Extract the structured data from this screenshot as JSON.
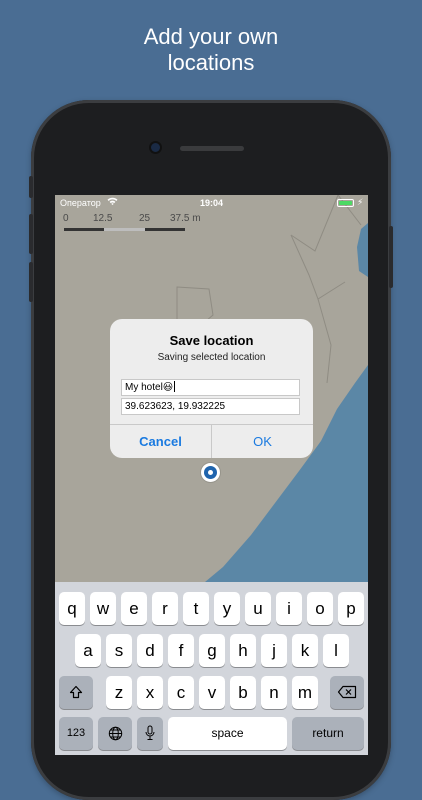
{
  "headline": {
    "line1": "Add your own",
    "line2": "locations"
  },
  "status": {
    "carrier": "Оператор",
    "time": "19:04"
  },
  "map": {
    "scale_labels": [
      "0",
      "12.5",
      "25",
      "37.5 m"
    ],
    "colors": {
      "land": "#a8a59b",
      "water": "#5b87a6",
      "road": "#8f8c83"
    }
  },
  "dialog": {
    "title": "Save location",
    "subtitle": "Saving selected location",
    "name_value": "My hotel😃",
    "coords_value": "39.623623, 19.932225",
    "cancel_label": "Cancel",
    "ok_label": "OK"
  },
  "keyboard": {
    "row1": [
      "q",
      "w",
      "e",
      "r",
      "t",
      "y",
      "u",
      "i",
      "o",
      "p"
    ],
    "row2": [
      "a",
      "s",
      "d",
      "f",
      "g",
      "h",
      "j",
      "k",
      "l"
    ],
    "row3": [
      "z",
      "x",
      "c",
      "v",
      "b",
      "n",
      "m"
    ],
    "numbers_label": "123",
    "space_label": "space",
    "return_label": "return"
  }
}
